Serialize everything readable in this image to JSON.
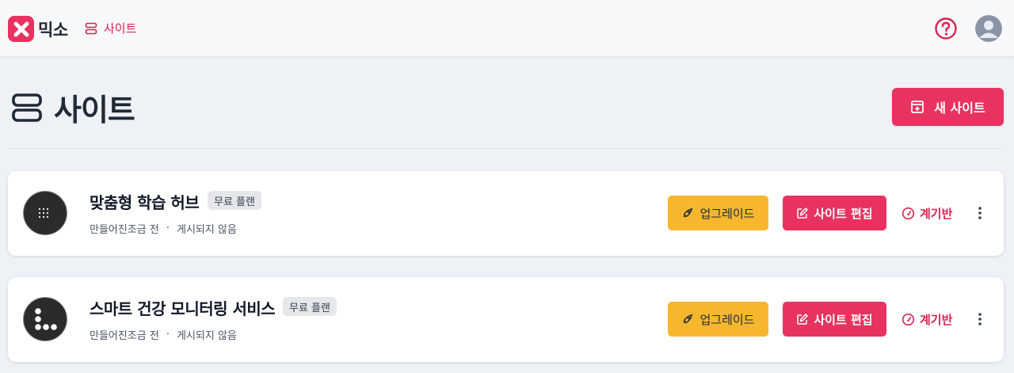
{
  "brand": {
    "name": "믹소",
    "color": "#e8325f"
  },
  "breadcrumb": {
    "label": "사이트",
    "icon": "sites-icon"
  },
  "header": {
    "help_icon": "help-circle-icon",
    "avatar_icon": "user-avatar-icon"
  },
  "page": {
    "title": "사이트",
    "icon": "sites-icon",
    "new_site_label": "새 사이트",
    "new_site_icon": "add-page-icon"
  },
  "sites": [
    {
      "name": "맞춤형 학습 허브",
      "plan": "무료 플랜",
      "created": "만들어진조금 전",
      "separator": "·",
      "status": "게시되지 않음",
      "icon": "dots-grid-icon",
      "upgrade_label": "업그레이드",
      "edit_label": "사이트 편집",
      "dashboard_label": "계기반"
    },
    {
      "name": "스마트 건강 모니터링 서비스",
      "plan": "무료 플랜",
      "created": "만들어진조금 전",
      "separator": "·",
      "status": "게시되지 않음",
      "icon": "circles-cluster-icon",
      "upgrade_label": "업그레이드",
      "edit_label": "사이트 편집",
      "dashboard_label": "계기반"
    }
  ],
  "colors": {
    "accent": "#e8325f",
    "upgrade": "#f6b72f",
    "background": "#eef1f5"
  }
}
